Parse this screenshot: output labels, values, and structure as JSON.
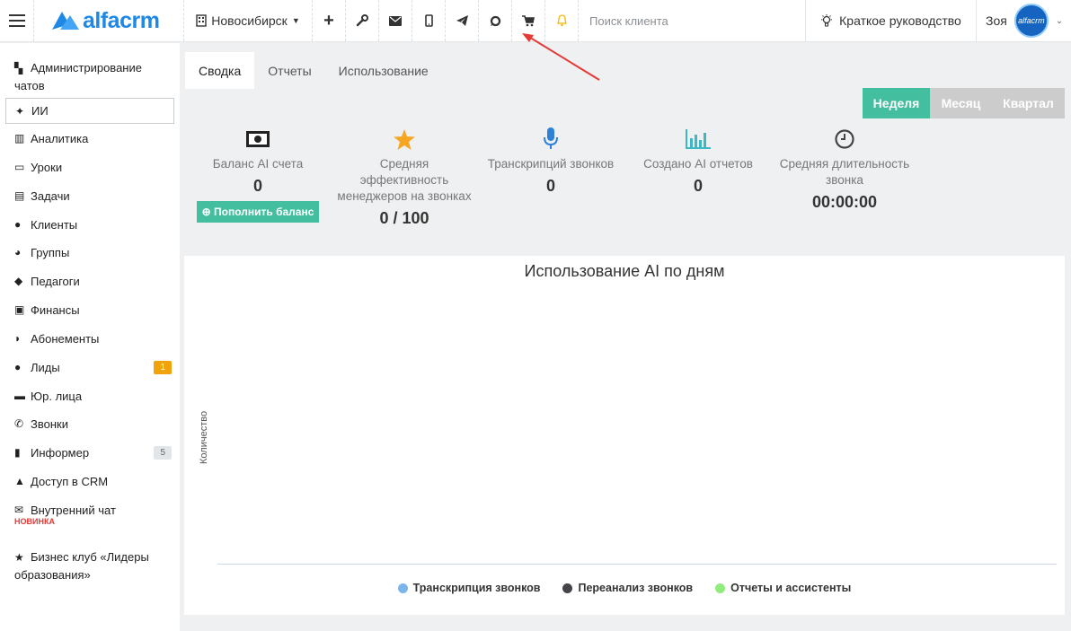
{
  "header": {
    "logo_text": "alfacrm",
    "city": "Новосибирск",
    "search_placeholder": "Поиск клиента",
    "guide_label": "Краткое руководство",
    "user_name": "Зоя",
    "avatar_text": "alfacrm",
    "icons": [
      "plus-icon",
      "wrench-icon",
      "envelope-icon",
      "mobile-icon",
      "telegram-icon",
      "chat-bubble-icon",
      "cart-icon",
      "bell-icon"
    ]
  },
  "sidebar": {
    "items": [
      {
        "icon": "chat-admin-icon",
        "label": "Администрирование чатов"
      },
      {
        "icon": "sparkle-icon",
        "label": "ИИ"
      },
      {
        "icon": "map-icon",
        "label": "Аналитика"
      },
      {
        "icon": "calendar-icon",
        "label": "Уроки"
      },
      {
        "icon": "clipboard-icon",
        "label": "Задачи"
      },
      {
        "icon": "user-icon",
        "label": "Клиенты"
      },
      {
        "icon": "users-icon",
        "label": "Группы"
      },
      {
        "icon": "graduation-icon",
        "label": "Педагоги"
      },
      {
        "icon": "money-icon",
        "label": "Финансы"
      },
      {
        "icon": "tag-icon",
        "label": "Абонементы"
      },
      {
        "icon": "user-plus-icon",
        "label": "Лиды",
        "badge": "1"
      },
      {
        "icon": "briefcase-icon",
        "label": "Юр. лица"
      },
      {
        "icon": "phone-icon",
        "label": "Звонки"
      },
      {
        "icon": "book-icon",
        "label": "Информер",
        "badge": "5"
      },
      {
        "icon": "lock-icon",
        "label": "Доступ в CRM"
      },
      {
        "icon": "envelope-icon",
        "label": "Внутренний чат",
        "tag": "НОВИНКА"
      },
      {
        "icon": "star-icon",
        "label": "Бизнес клуб «Лидеры образования»"
      }
    ]
  },
  "tabs": [
    "Сводка",
    "Отчеты",
    "Использование"
  ],
  "periods": [
    "Неделя",
    "Месяц",
    "Квартал"
  ],
  "stats": [
    {
      "label": "Баланс AI счета",
      "value": "0",
      "button": "Пополнить баланс"
    },
    {
      "label": "Средняя эффективность менеджеров на звонках",
      "value": "0 / 100"
    },
    {
      "label": "Транскрипций звонков",
      "value": "0"
    },
    {
      "label": "Создано AI отчетов",
      "value": "0"
    },
    {
      "label": "Средняя длительность звонка",
      "value": "00:00:00"
    }
  ],
  "chart_data": {
    "type": "line",
    "title": "Использование AI по дням",
    "ylabel": "Количество",
    "xlabel": "",
    "series": [
      {
        "name": "Транскрипция звонков",
        "color": "#7cb5ec",
        "values": []
      },
      {
        "name": "Переанализ звонков",
        "color": "#434348",
        "values": []
      },
      {
        "name": "Отчеты и ассистенты",
        "color": "#90ed7d",
        "values": []
      }
    ],
    "legend": "bottom"
  },
  "colors": {
    "accent": "#43bf9f",
    "brand": "#1e88e5",
    "period_off": "#cccccc",
    "badge_orange": "#f0a30a"
  }
}
